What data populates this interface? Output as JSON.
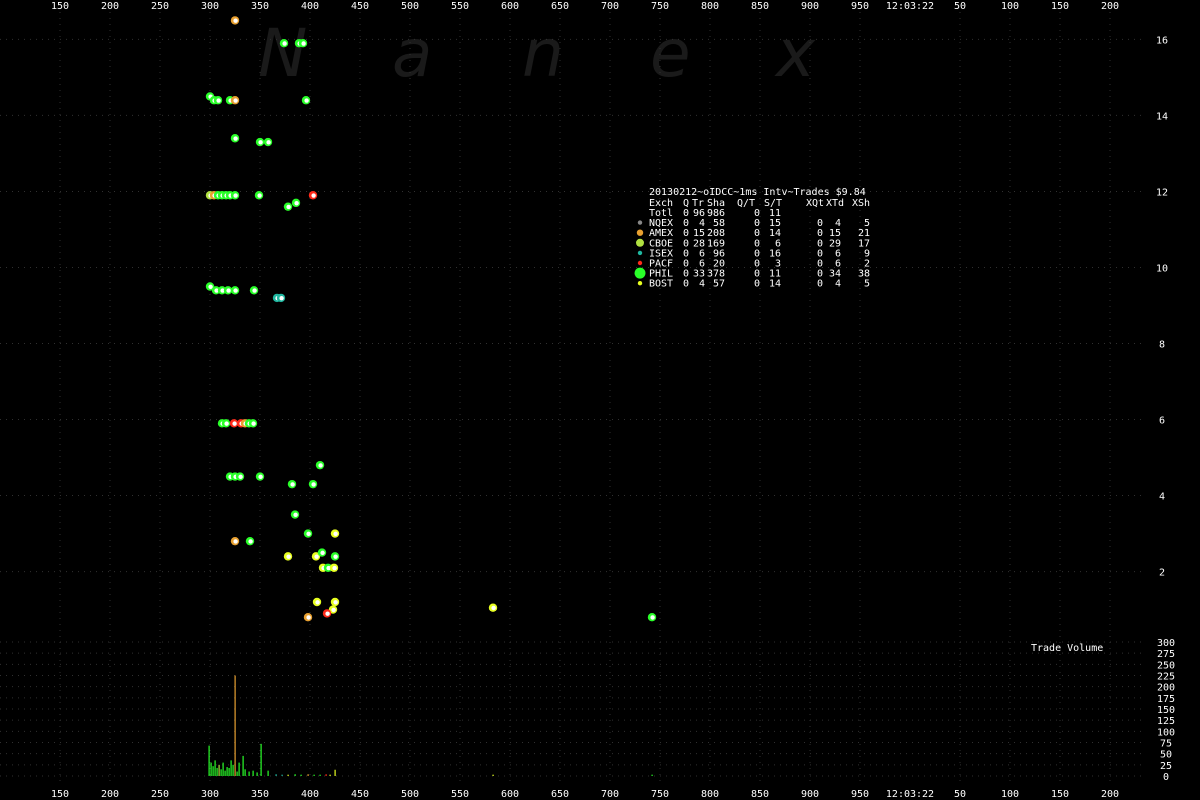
{
  "watermark": [
    "N",
    "a",
    "n",
    "e",
    "x"
  ],
  "time_label": "12:03:22",
  "volume_title": "Trade Volume",
  "colors": {
    "background": "#000000",
    "grid": "#303030",
    "nqex": "#888888",
    "amex": "#e8a030",
    "cboe": "#b0e040",
    "isex": "#1fb7a0",
    "pacf": "#ff2a1a",
    "phil": "#29ff29",
    "bost": "#e8ff20",
    "marker_center": "#ffffff"
  },
  "legend": {
    "title": "20130212~oIDCC~1ms Intv~Trades $9.84",
    "headers": [
      "Exch",
      "Q",
      "Tr",
      "Sha",
      "Q/T",
      "S/T",
      "XQt",
      "XTd",
      "XSh"
    ],
    "rows": [
      {
        "name": "Totl",
        "color": "",
        "cells": [
          "0",
          "96",
          "986",
          "0",
          "11",
          "",
          "",
          ""
        ]
      },
      {
        "name": "NQEX",
        "color": "#888888",
        "cells": [
          "0",
          "4",
          "58",
          "0",
          "15",
          "0",
          "4",
          "5"
        ]
      },
      {
        "name": "AMEX",
        "color": "#e8a030",
        "cells": [
          "0",
          "15",
          "208",
          "0",
          "14",
          "0",
          "15",
          "21"
        ]
      },
      {
        "name": "CBOE",
        "color": "#b0e040",
        "cells": [
          "0",
          "28",
          "169",
          "0",
          "6",
          "0",
          "29",
          "17"
        ]
      },
      {
        "name": "ISEX",
        "color": "#1fb7a0",
        "cells": [
          "0",
          "6",
          "96",
          "0",
          "16",
          "0",
          "6",
          "9"
        ]
      },
      {
        "name": "PACF",
        "color": "#ff2a1a",
        "cells": [
          "0",
          "6",
          "20",
          "0",
          "3",
          "0",
          "6",
          "2"
        ]
      },
      {
        "name": "PHIL",
        "color": "#29ff29",
        "cells": [
          "0",
          "33",
          "378",
          "0",
          "11",
          "0",
          "34",
          "38"
        ]
      },
      {
        "name": "BOST",
        "color": "#e8ff20",
        "cells": [
          "0",
          "4",
          "57",
          "0",
          "14",
          "0",
          "4",
          "5"
        ]
      }
    ]
  },
  "chart_data": {
    "type": "scatter",
    "x_ticks_before_time": [
      "150",
      "200",
      "250",
      "300",
      "350",
      "400",
      "450",
      "500",
      "550",
      "600",
      "650",
      "700",
      "750",
      "800",
      "850",
      "900",
      "950"
    ],
    "x_ticks_after_time": [
      "50",
      "100",
      "150",
      "200"
    ],
    "y_ticks": [
      "2",
      "4",
      "6",
      "8",
      "10",
      "12",
      "14",
      "16"
    ],
    "ylim": [
      0.2,
      16.8
    ],
    "volume_ticks": [
      "0",
      "25",
      "50",
      "75",
      "100",
      "125",
      "150",
      "175",
      "200",
      "225",
      "250",
      "275",
      "300"
    ],
    "volume_ylim": [
      0,
      300
    ],
    "trades": [
      {
        "x": 325,
        "y": 16.5,
        "exch": "AMEX"
      },
      {
        "x": 374,
        "y": 15.9,
        "exch": "PHIL"
      },
      {
        "x": 389,
        "y": 15.9,
        "exch": "PHIL"
      },
      {
        "x": 393,
        "y": 15.9,
        "exch": "PHIL"
      },
      {
        "x": 300,
        "y": 14.5,
        "exch": "PHIL"
      },
      {
        "x": 304,
        "y": 14.4,
        "exch": "PHIL"
      },
      {
        "x": 308,
        "y": 14.4,
        "exch": "PHIL"
      },
      {
        "x": 320,
        "y": 14.4,
        "exch": "PHIL"
      },
      {
        "x": 325,
        "y": 14.4,
        "exch": "AMEX"
      },
      {
        "x": 396,
        "y": 14.4,
        "exch": "PHIL"
      },
      {
        "x": 325,
        "y": 13.4,
        "exch": "PHIL"
      },
      {
        "x": 350,
        "y": 13.3,
        "exch": "PHIL"
      },
      {
        "x": 358,
        "y": 13.3,
        "exch": "PHIL"
      },
      {
        "x": 300,
        "y": 11.9,
        "exch": "CBOE"
      },
      {
        "x": 304,
        "y": 11.9,
        "exch": "AMEX"
      },
      {
        "x": 308,
        "y": 11.9,
        "exch": "PHIL"
      },
      {
        "x": 312,
        "y": 11.9,
        "exch": "PHIL"
      },
      {
        "x": 316,
        "y": 11.9,
        "exch": "PHIL"
      },
      {
        "x": 320,
        "y": 11.9,
        "exch": "PHIL"
      },
      {
        "x": 325,
        "y": 11.9,
        "exch": "PHIL"
      },
      {
        "x": 349,
        "y": 11.9,
        "exch": "PHIL"
      },
      {
        "x": 378,
        "y": 11.6,
        "exch": "PHIL"
      },
      {
        "x": 386,
        "y": 11.7,
        "exch": "PHIL"
      },
      {
        "x": 403,
        "y": 11.9,
        "exch": "PACF"
      },
      {
        "x": 300,
        "y": 9.5,
        "exch": "PHIL"
      },
      {
        "x": 306,
        "y": 9.4,
        "exch": "PHIL"
      },
      {
        "x": 312,
        "y": 9.4,
        "exch": "PHIL"
      },
      {
        "x": 318,
        "y": 9.4,
        "exch": "PHIL"
      },
      {
        "x": 325,
        "y": 9.4,
        "exch": "PHIL"
      },
      {
        "x": 344,
        "y": 9.4,
        "exch": "PHIL"
      },
      {
        "x": 367,
        "y": 9.2,
        "exch": "ISEX"
      },
      {
        "x": 371,
        "y": 9.2,
        "exch": "ISEX"
      },
      {
        "x": 312,
        "y": 5.9,
        "exch": "PHIL"
      },
      {
        "x": 316,
        "y": 5.9,
        "exch": "PHIL"
      },
      {
        "x": 324,
        "y": 5.9,
        "exch": "PACF"
      },
      {
        "x": 331,
        "y": 5.9,
        "exch": "PACF"
      },
      {
        "x": 335,
        "y": 5.9,
        "exch": "AMEX"
      },
      {
        "x": 339,
        "y": 5.9,
        "exch": "PHIL"
      },
      {
        "x": 343,
        "y": 5.9,
        "exch": "PHIL"
      },
      {
        "x": 320,
        "y": 4.5,
        "exch": "PHIL"
      },
      {
        "x": 325,
        "y": 4.5,
        "exch": "PHIL"
      },
      {
        "x": 330,
        "y": 4.5,
        "exch": "PHIL"
      },
      {
        "x": 350,
        "y": 4.5,
        "exch": "PHIL"
      },
      {
        "x": 382,
        "y": 4.3,
        "exch": "PHIL"
      },
      {
        "x": 403,
        "y": 4.3,
        "exch": "PHIL"
      },
      {
        "x": 410,
        "y": 4.8,
        "exch": "PHIL"
      },
      {
        "x": 385,
        "y": 3.5,
        "exch": "PHIL"
      },
      {
        "x": 398,
        "y": 3.0,
        "exch": "PHIL"
      },
      {
        "x": 425,
        "y": 3.0,
        "exch": "BOST"
      },
      {
        "x": 325,
        "y": 2.8,
        "exch": "AMEX"
      },
      {
        "x": 340,
        "y": 2.8,
        "exch": "PHIL"
      },
      {
        "x": 378,
        "y": 2.4,
        "exch": "BOST"
      },
      {
        "x": 406,
        "y": 2.4,
        "exch": "BOST"
      },
      {
        "x": 412,
        "y": 2.5,
        "exch": "PHIL"
      },
      {
        "x": 425,
        "y": 2.4,
        "exch": "PHIL"
      },
      {
        "x": 413,
        "y": 2.1,
        "exch": "BOST"
      },
      {
        "x": 418,
        "y": 2.1,
        "exch": "PHIL"
      },
      {
        "x": 424,
        "y": 2.1,
        "exch": "BOST"
      },
      {
        "x": 407,
        "y": 1.2,
        "exch": "BOST"
      },
      {
        "x": 425,
        "y": 1.2,
        "exch": "BOST"
      },
      {
        "x": 423,
        "y": 1.0,
        "exch": "BOST"
      },
      {
        "x": 417,
        "y": 0.9,
        "exch": "PACF"
      },
      {
        "x": 398,
        "y": 0.8,
        "exch": "AMEX"
      },
      {
        "x": 583,
        "y": 1.05,
        "exch": "BOST"
      },
      {
        "x": 742,
        "y": 0.8,
        "exch": "PHIL"
      }
    ],
    "volume": [
      {
        "x": 299,
        "v": 68,
        "exch": "PHIL"
      },
      {
        "x": 301,
        "v": 30,
        "exch": "PHIL"
      },
      {
        "x": 303,
        "v": 22,
        "exch": "PHIL"
      },
      {
        "x": 305,
        "v": 35,
        "exch": "PHIL"
      },
      {
        "x": 307,
        "v": 18,
        "exch": "PHIL"
      },
      {
        "x": 309,
        "v": 25,
        "exch": "CBOE"
      },
      {
        "x": 311,
        "v": 15,
        "exch": "PHIL"
      },
      {
        "x": 313,
        "v": 30,
        "exch": "PHIL"
      },
      {
        "x": 315,
        "v": 12,
        "exch": "PHIL"
      },
      {
        "x": 317,
        "v": 20,
        "exch": "PHIL"
      },
      {
        "x": 319,
        "v": 18,
        "exch": "PHIL"
      },
      {
        "x": 321,
        "v": 35,
        "exch": "PHIL"
      },
      {
        "x": 323,
        "v": 25,
        "exch": "PHIL"
      },
      {
        "x": 325,
        "v": 225,
        "exch": "AMEX"
      },
      {
        "x": 327,
        "v": 10,
        "exch": "PHIL"
      },
      {
        "x": 329,
        "v": 30,
        "exch": "PHIL"
      },
      {
        "x": 333,
        "v": 45,
        "exch": "PHIL"
      },
      {
        "x": 335,
        "v": 15,
        "exch": "PHIL"
      },
      {
        "x": 339,
        "v": 10,
        "exch": "PHIL"
      },
      {
        "x": 343,
        "v": 12,
        "exch": "PHIL"
      },
      {
        "x": 347,
        "v": 8,
        "exch": "PHIL"
      },
      {
        "x": 351,
        "v": 72,
        "exch": "PHIL"
      },
      {
        "x": 358,
        "v": 12,
        "exch": "PHIL"
      },
      {
        "x": 366,
        "v": 4,
        "exch": "ISEX"
      },
      {
        "x": 372,
        "v": 3,
        "exch": "ISEX"
      },
      {
        "x": 378,
        "v": 3,
        "exch": "BOST"
      },
      {
        "x": 385,
        "v": 4,
        "exch": "PHIL"
      },
      {
        "x": 391,
        "v": 3,
        "exch": "PHIL"
      },
      {
        "x": 398,
        "v": 4,
        "exch": "AMEX"
      },
      {
        "x": 404,
        "v": 3,
        "exch": "PHIL"
      },
      {
        "x": 410,
        "v": 3,
        "exch": "PHIL"
      },
      {
        "x": 416,
        "v": 4,
        "exch": "PACF"
      },
      {
        "x": 420,
        "v": 3,
        "exch": "BOST"
      },
      {
        "x": 425,
        "v": 14,
        "exch": "BOST"
      },
      {
        "x": 583,
        "v": 3,
        "exch": "BOST"
      },
      {
        "x": 742,
        "v": 3,
        "exch": "PHIL"
      }
    ]
  }
}
